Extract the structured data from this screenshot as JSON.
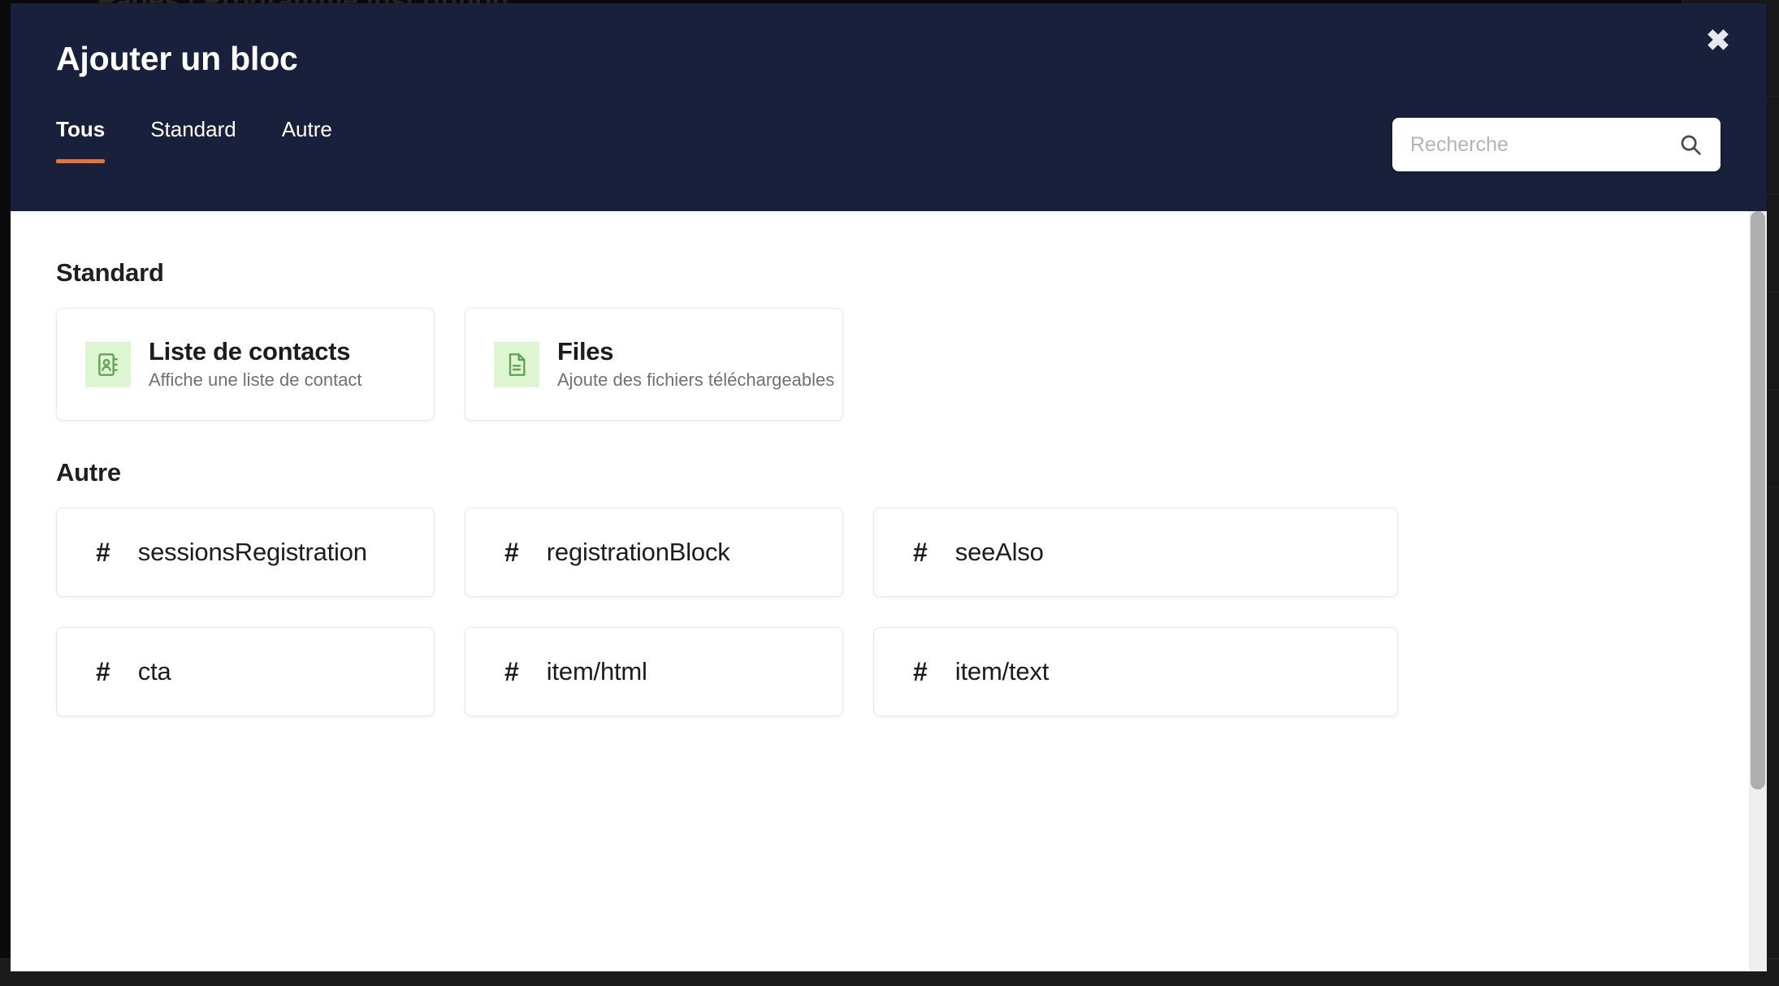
{
  "background": {
    "breadcrumb": "Pages / Programme inscription",
    "menu_icon": "hamburger-menu-icon"
  },
  "modal": {
    "title": "Ajouter un bloc",
    "close_label": "✖",
    "accent_color": "#e8743b",
    "header_color": "#18203c",
    "tabs": [
      {
        "label": "Tous",
        "active": true
      },
      {
        "label": "Standard",
        "active": false
      },
      {
        "label": "Autre",
        "active": false
      }
    ],
    "search": {
      "placeholder": "Recherche",
      "value": "",
      "icon": "search-icon"
    },
    "sections": [
      {
        "heading": "Standard",
        "type": "standard",
        "cards": [
          {
            "title": "Liste de contacts",
            "description": "Affiche une liste de contact",
            "icon": "address-book-icon",
            "icon_color": "#63a354",
            "icon_bg": "#dff6d3"
          },
          {
            "title": "Files",
            "description": "Ajoute des fichiers téléchargeables",
            "icon": "file-document-icon",
            "icon_color": "#63a354",
            "icon_bg": "#dff6d3"
          }
        ]
      },
      {
        "heading": "Autre",
        "type": "other",
        "cards": [
          {
            "title": "sessionsRegistration",
            "icon": "hash-icon",
            "glyph": "#"
          },
          {
            "title": "registrationBlock",
            "icon": "hash-icon",
            "glyph": "#"
          },
          {
            "title": "seeAlso",
            "icon": "hash-icon",
            "glyph": "#"
          },
          {
            "title": "cta",
            "icon": "hash-icon",
            "glyph": "#"
          },
          {
            "title": "item/html",
            "icon": "hash-icon",
            "glyph": "#"
          },
          {
            "title": "item/text",
            "icon": "hash-icon",
            "glyph": "#"
          }
        ]
      }
    ],
    "scrollbar": {
      "name": "vertical-scrollbar"
    }
  }
}
